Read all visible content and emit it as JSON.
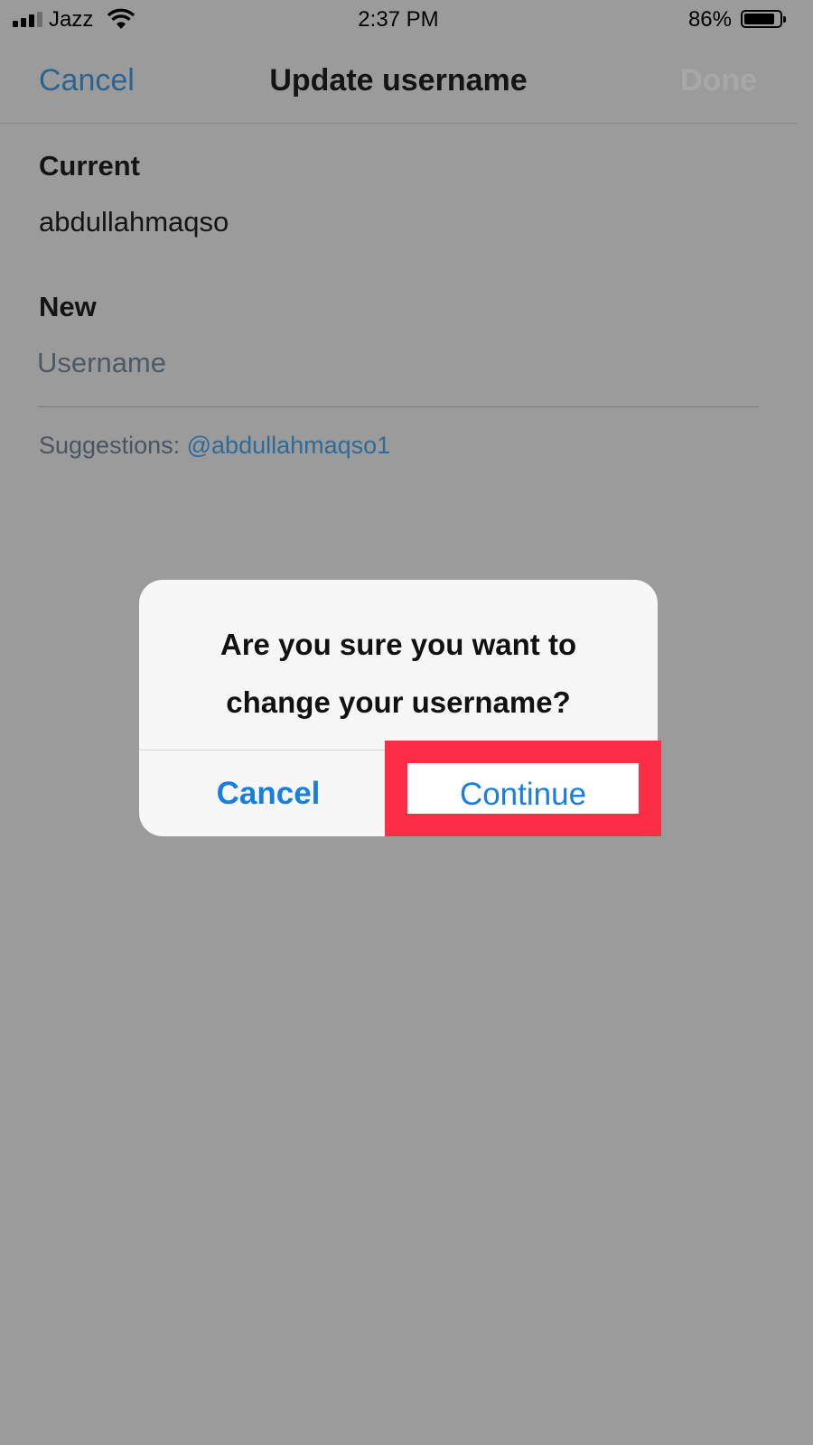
{
  "status_bar": {
    "carrier": "Jazz",
    "time": "2:37 PM",
    "battery_percent": "86%",
    "battery_level": 0.86
  },
  "navbar": {
    "cancel_label": "Cancel",
    "title": "Update username",
    "done_label": "Done"
  },
  "form": {
    "current_label": "Current",
    "current_value": "abdullahmaqso",
    "new_label": "New",
    "new_placeholder": "Username",
    "suggestions_label": "Suggestions:",
    "suggestion": "@abdullahmaqso1"
  },
  "alert": {
    "message_line1": "Are you sure you want to",
    "message_line2": "change your username?",
    "cancel_label": "Cancel",
    "continue_label": "Continue"
  },
  "colors": {
    "overlay": "#9b9b9b",
    "link_blue": "#1a7ee0",
    "highlight": "#fd2d45"
  }
}
